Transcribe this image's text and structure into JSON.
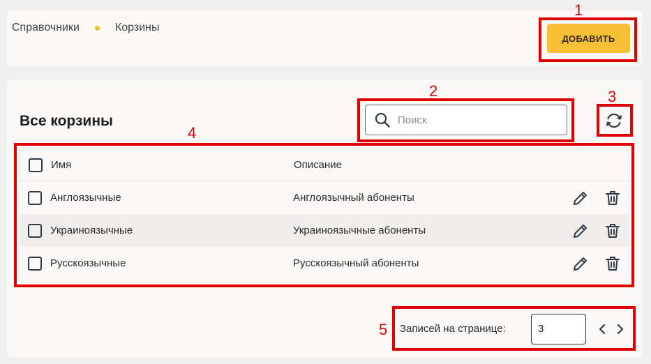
{
  "breadcrumb": {
    "parent": "Справочники",
    "current": "Корзины"
  },
  "toolbar": {
    "add_label": "ДОБАВИТЬ"
  },
  "page": {
    "title": "Все корзины"
  },
  "search": {
    "placeholder": "Поиск",
    "value": ""
  },
  "table": {
    "columns": {
      "name": "Имя",
      "description": "Описание"
    },
    "rows": [
      {
        "name": "Англоязычные",
        "description": "Англоязычный абоненты"
      },
      {
        "name": "Украиноязычные",
        "description": "Украиноязычные абоненты"
      },
      {
        "name": "Русскоязычные",
        "description": "Русскоязычный абоненты"
      }
    ]
  },
  "pagination": {
    "label": "Записей на странице:",
    "page_size": "3"
  },
  "annotations": [
    "1",
    "2",
    "3",
    "4",
    "5"
  ],
  "colors": {
    "accent": "#f8bf36",
    "annotation": "#e00000",
    "icon": "#2f3b47"
  },
  "icons": [
    "search-icon",
    "refresh-icon",
    "edit-icon",
    "trash-icon",
    "chevron-left-icon",
    "chevron-right-icon"
  ]
}
